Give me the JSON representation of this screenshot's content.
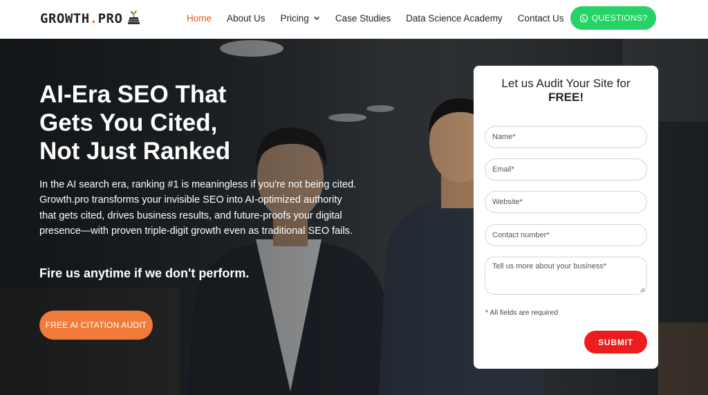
{
  "logo": {
    "text_main": "GROWTH",
    "text_dot": ".",
    "text_suffix": "PRO",
    "icon": "growth-plant-books-icon"
  },
  "nav": {
    "items": [
      {
        "label": "Home",
        "active": true
      },
      {
        "label": "About Us"
      },
      {
        "label": "Pricing",
        "has_dropdown": true
      },
      {
        "label": "Case Studies"
      },
      {
        "label": "Data Science Academy"
      },
      {
        "label": "Contact Us"
      }
    ],
    "cta": {
      "label": "QUESTIONS?",
      "icon": "whatsapp-icon"
    }
  },
  "hero": {
    "headline_line1": "AI-Era SEO That",
    "headline_line2": "Gets You Cited,",
    "headline_line3": "Not Just Ranked",
    "description": "In the AI search era, ranking #1 is meaningless if you're not being cited. Growth.pro transforms your invisible SEO into AI-optimized authority that gets cited, drives business results, and future-proofs your digital presence—with proven triple-digit growth even as traditional SEO fails.",
    "tagline": "Fire us anytime if we don't perform.",
    "cta_label": "FREE AI CITATION AUDIT"
  },
  "form": {
    "title_line1": "Let us Audit Your Site for",
    "title_line2": "FREE!",
    "fields": {
      "name": "Name*",
      "email": "Email*",
      "website": "Website*",
      "contact": "Contact number*",
      "business": "Tell us more about your business*"
    },
    "required_note": "* All fields are required",
    "submit_label": "SUBMIT"
  },
  "colors": {
    "nav_active": "#e8532a",
    "whatsapp_green": "#25d366",
    "audit_orange": "#f07b3a",
    "submit_red": "#ee1c1c"
  }
}
